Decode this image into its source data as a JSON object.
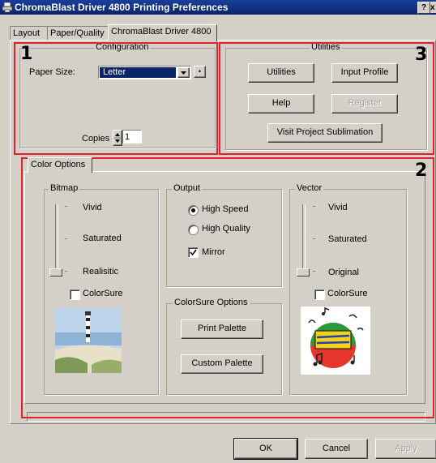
{
  "window": {
    "title": "ChromaBlast Driver 4800 Printing Preferences",
    "help_glyph": "?",
    "close_glyph": "x"
  },
  "tabs": [
    "Layout",
    "Paper/Quality",
    "ChromaBlast Driver 4800"
  ],
  "callouts": [
    "1",
    "2",
    "3"
  ],
  "configuration": {
    "label": "Configuration",
    "paper_size_label": "Paper Size:",
    "paper_size_value": "Letter",
    "copies_label": "Copies",
    "copies_value": "1",
    "small_button_glyph": "•"
  },
  "utilities": {
    "label": "Utilities",
    "utilities_button": "Utilities",
    "input_profile_button": "Input Profile",
    "help_button": "Help",
    "register_button": "Register",
    "visit_button": "Visit Project Sublimation"
  },
  "color_options": {
    "tab_label": "Color Options",
    "bitmap": {
      "label": "Bitmap",
      "levels": [
        "Vivid",
        "Saturated",
        "Realisitic"
      ],
      "selected_level": "Realisitic",
      "colorsure_label": "ColorSure",
      "colorsure_checked": false
    },
    "output": {
      "label": "Output",
      "high_speed": "High Speed",
      "high_quality": "High Quality",
      "selected": "High Speed",
      "mirror_label": "Mirror",
      "mirror_checked": true
    },
    "colorsure_options": {
      "label": "ColorSure Options",
      "print_palette": "Print Palette",
      "custom_palette": "Custom Palette"
    },
    "vector": {
      "label": "Vector",
      "levels": [
        "Vivid",
        "Saturated",
        "Original"
      ],
      "selected_level": "Original",
      "colorsure_label": "ColorSure",
      "colorsure_checked": false
    }
  },
  "footer": {
    "ok": "OK",
    "cancel": "Cancel",
    "apply": "Apply"
  },
  "colors": {
    "highlight": "#e0202a",
    "titlebar": "#0a246a",
    "face": "#d4d0c8"
  }
}
